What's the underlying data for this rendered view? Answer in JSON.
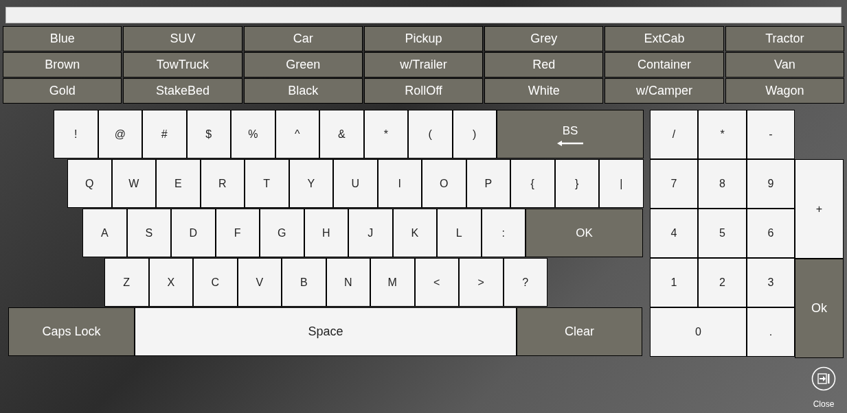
{
  "quick_buttons": [
    [
      "Blue",
      "SUV",
      "Car",
      "Pickup",
      "Grey",
      "ExtCab",
      "Tractor"
    ],
    [
      "Brown",
      "TowTruck",
      "Green",
      "w/Trailer",
      "Red",
      "Container",
      "Van"
    ],
    [
      "Gold",
      "StakeBed",
      "Black",
      "RollOff",
      "White",
      "w/Camper",
      "Wagon"
    ]
  ],
  "keyboard_rows": [
    {
      "keys": [
        {
          "kind": "key",
          "label": "!"
        },
        {
          "kind": "key",
          "label": "@"
        },
        {
          "kind": "key",
          "label": "#"
        },
        {
          "kind": "key",
          "label": "$"
        },
        {
          "kind": "key",
          "label": "%"
        },
        {
          "kind": "key",
          "label": "^"
        },
        {
          "kind": "key",
          "label": "&"
        },
        {
          "kind": "key",
          "label": "*"
        },
        {
          "kind": "key",
          "label": "("
        },
        {
          "kind": "key",
          "label": ")"
        },
        {
          "kind": "backspace",
          "label": "BS"
        }
      ]
    },
    {
      "keys": [
        {
          "kind": "key",
          "label": "Q"
        },
        {
          "kind": "key",
          "label": "W"
        },
        {
          "kind": "key",
          "label": "E"
        },
        {
          "kind": "key",
          "label": "R"
        },
        {
          "kind": "key",
          "label": "T"
        },
        {
          "kind": "key",
          "label": "Y"
        },
        {
          "kind": "key",
          "label": "U"
        },
        {
          "kind": "key",
          "label": "I"
        },
        {
          "kind": "key",
          "label": "O"
        },
        {
          "kind": "key",
          "label": "P"
        },
        {
          "kind": "key",
          "label": "{"
        },
        {
          "kind": "key",
          "label": "}"
        },
        {
          "kind": "key",
          "label": "|"
        }
      ]
    },
    {
      "keys": [
        {
          "kind": "key",
          "label": "A"
        },
        {
          "kind": "key",
          "label": "S"
        },
        {
          "kind": "key",
          "label": "D"
        },
        {
          "kind": "key",
          "label": "F"
        },
        {
          "kind": "key",
          "label": "G"
        },
        {
          "kind": "key",
          "label": "H"
        },
        {
          "kind": "key",
          "label": "J"
        },
        {
          "kind": "key",
          "label": "K"
        },
        {
          "kind": "key",
          "label": "L"
        },
        {
          "kind": "key",
          "label": ":"
        },
        {
          "kind": "enter",
          "label": "OK"
        }
      ]
    },
    {
      "keys": [
        {
          "kind": "key",
          "label": "Z"
        },
        {
          "kind": "key",
          "label": "X"
        },
        {
          "kind": "key",
          "label": "C"
        },
        {
          "kind": "key",
          "label": "V"
        },
        {
          "kind": "key",
          "label": "B"
        },
        {
          "kind": "key",
          "label": "N"
        },
        {
          "kind": "key",
          "label": "M"
        },
        {
          "kind": "key",
          "label": "<"
        },
        {
          "kind": "key",
          "label": ">"
        },
        {
          "kind": "key",
          "label": "?"
        }
      ]
    },
    {
      "keys": [
        {
          "kind": "caps",
          "label": "Caps Lock"
        },
        {
          "kind": "space",
          "label": "Space"
        },
        {
          "kind": "clear",
          "label": "Clear"
        }
      ]
    }
  ],
  "numpad": [
    {
      "kind": "key",
      "label": "/"
    },
    {
      "kind": "key",
      "label": "*"
    },
    {
      "kind": "key",
      "label": "-"
    },
    {
      "kind": "key",
      "label": "7"
    },
    {
      "kind": "key",
      "label": "8"
    },
    {
      "kind": "key",
      "label": "9"
    },
    {
      "kind": "key",
      "label": "4"
    },
    {
      "kind": "key",
      "label": "5"
    },
    {
      "kind": "key",
      "label": "6"
    },
    {
      "kind": "key",
      "label": "1"
    },
    {
      "kind": "key",
      "label": "2"
    },
    {
      "kind": "key",
      "label": "3"
    },
    {
      "kind": "zero",
      "label": "0"
    },
    {
      "kind": "key",
      "label": "."
    }
  ],
  "numpad_side": [
    {
      "kind": "plus",
      "label": "+"
    },
    {
      "kind": "ok",
      "label": "Ok"
    }
  ],
  "close": {
    "label": "Close"
  }
}
